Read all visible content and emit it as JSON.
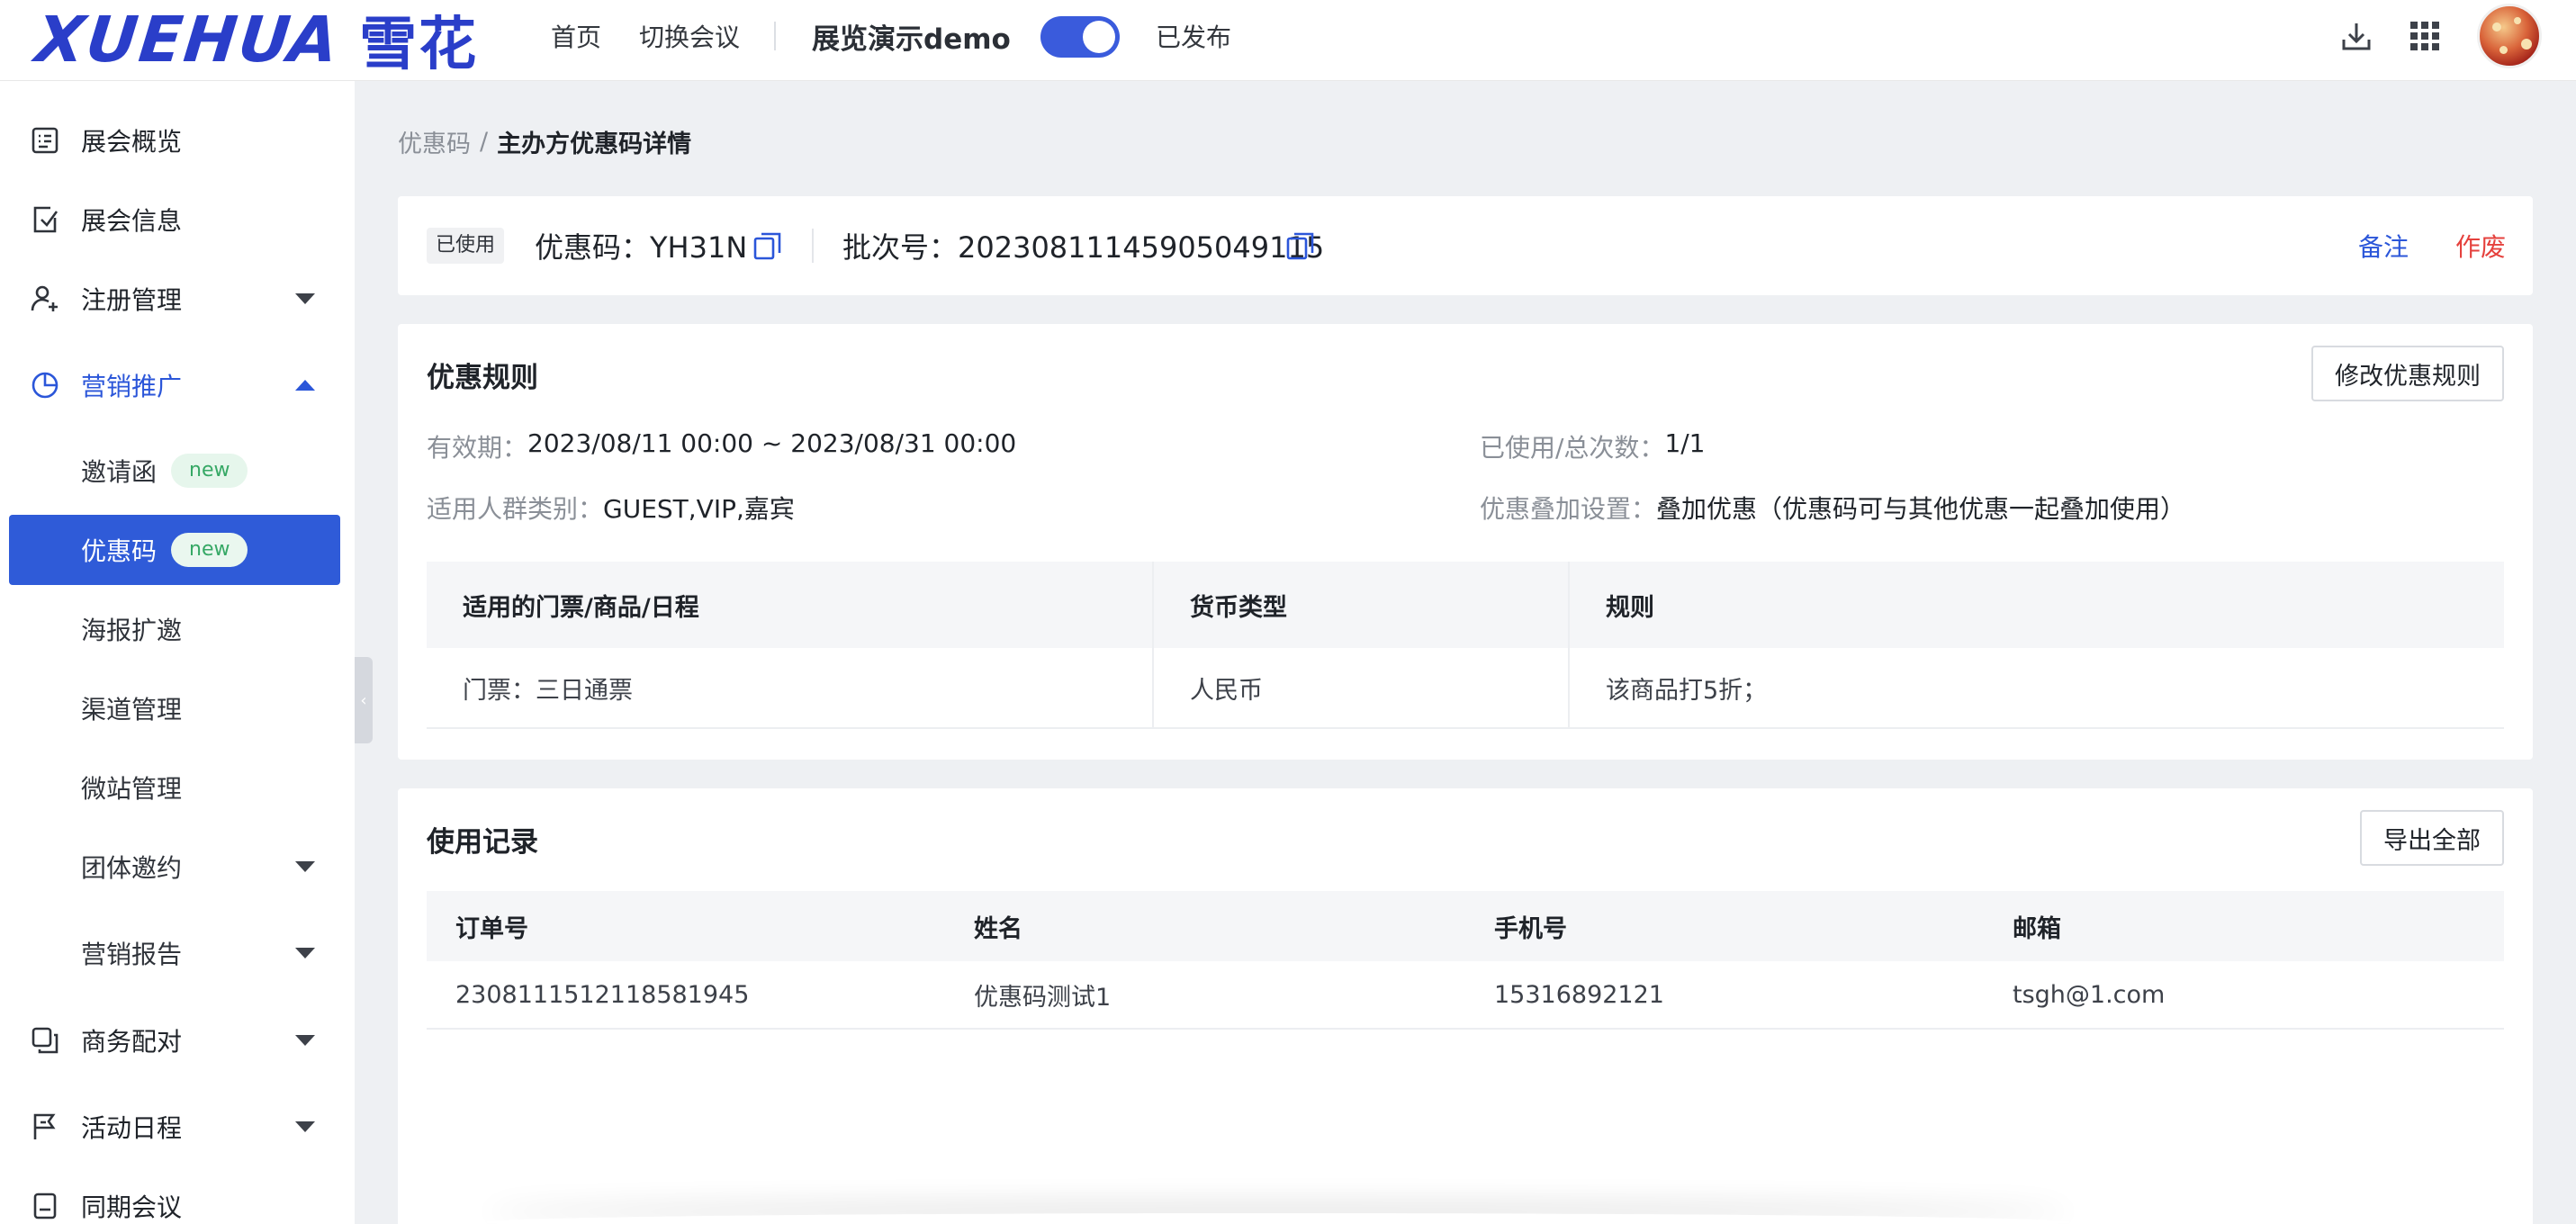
{
  "header": {
    "logo_en": "XUEHUA",
    "logo_cn": "雪花",
    "nav_home": "首页",
    "nav_switch": "切换会议",
    "expo_name": "展览演示demo",
    "published": "已发布"
  },
  "sidebar": {
    "items": [
      {
        "label": "展会概览"
      },
      {
        "label": "展会信息"
      },
      {
        "label": "注册管理"
      },
      {
        "label": "营销推广"
      },
      {
        "label": "商务配对"
      },
      {
        "label": "活动日程"
      },
      {
        "label": "同期会议"
      }
    ],
    "sub_items": [
      {
        "label": "邀请函",
        "badge": "new"
      },
      {
        "label": "优惠码",
        "badge": "new"
      },
      {
        "label": "海报扩邀"
      },
      {
        "label": "渠道管理"
      },
      {
        "label": "微站管理"
      },
      {
        "label": "团体邀约"
      },
      {
        "label": "营销报告"
      }
    ]
  },
  "breadcrumb": {
    "parent": "优惠码",
    "separator": "/",
    "current": "主办方优惠码详情"
  },
  "code_card": {
    "status": "已使用",
    "code_label": "优惠码：YH31N",
    "batch_label": "批次号：20230811145905049115",
    "note_link": "备注",
    "void_link": "作废"
  },
  "rules_card": {
    "title": "优惠规则",
    "edit_button": "修改优惠规则",
    "validity_key": "有效期：",
    "validity_value": "2023/08/11 00:00 ~ 2023/08/31 00:00",
    "usage_key": "已使用/总次数：",
    "usage_value": "1/1",
    "audience_key": "适用人群类别：",
    "audience_value": "GUEST,VIP,嘉宾",
    "stack_key": "优惠叠加设置：",
    "stack_value": "叠加优惠（优惠码可与其他优惠一起叠加使用）",
    "table": {
      "headers": [
        "适用的门票/商品/日程",
        "货币类型",
        "规则"
      ],
      "rows": [
        [
          "门票：三日通票",
          "人民币",
          "该商品打5折；"
        ]
      ]
    }
  },
  "usage_card": {
    "title": "使用记录",
    "export_button": "导出全部",
    "table": {
      "headers": [
        "订单号",
        "姓名",
        "手机号",
        "邮箱"
      ],
      "rows": [
        [
          "2308111512118581945",
          "优惠码测试1",
          "15316892121",
          "tsgh@1.com"
        ]
      ]
    }
  },
  "colors": {
    "accent": "#2f5bd8",
    "danger": "#e5413d",
    "badge_green": "#36a865"
  }
}
